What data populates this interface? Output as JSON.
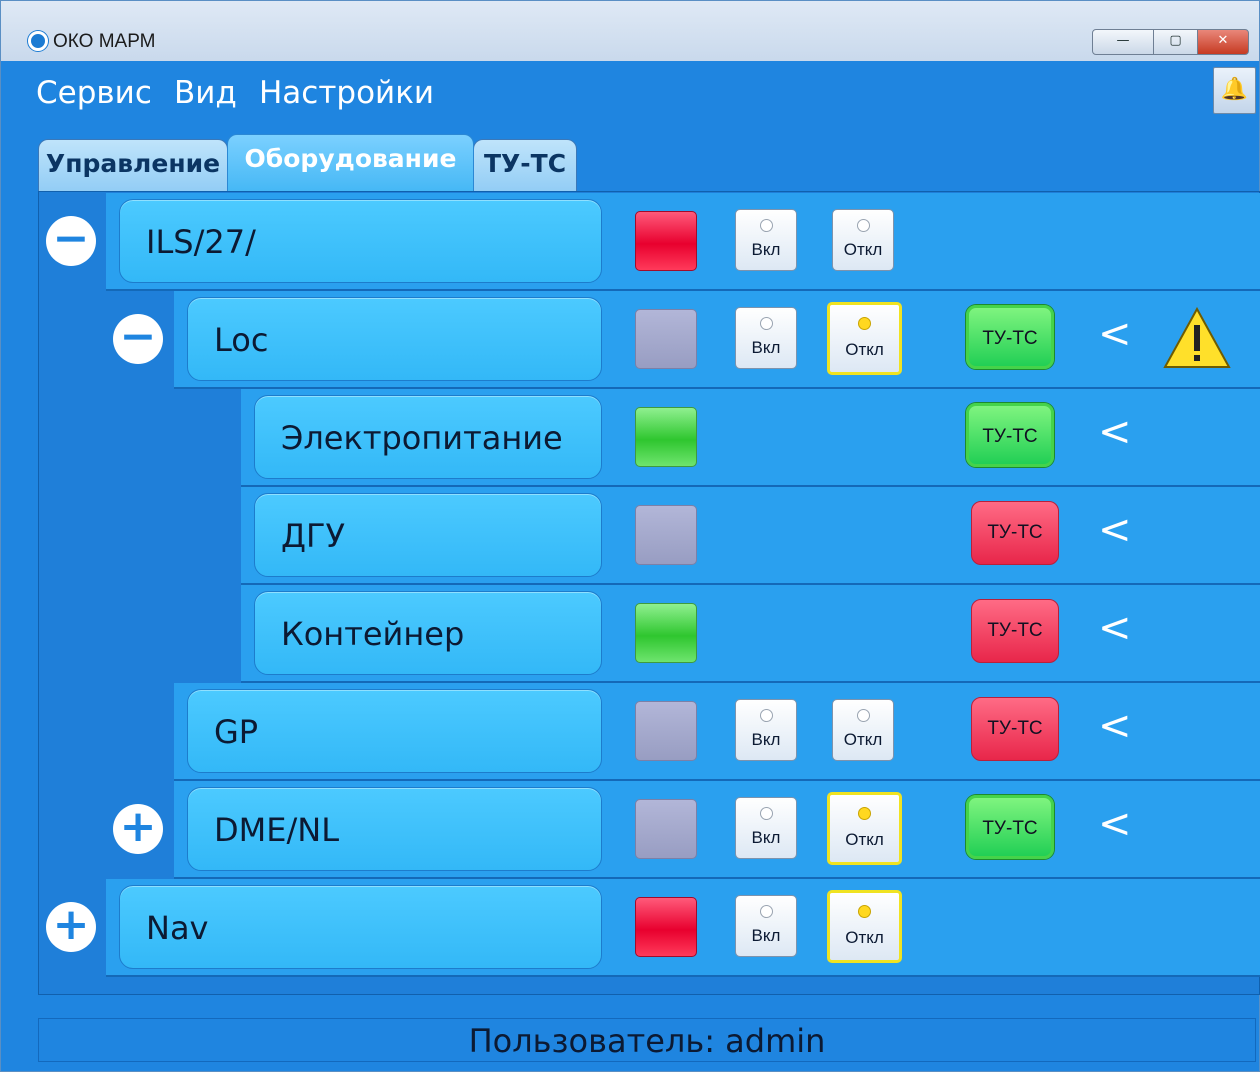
{
  "window": {
    "title": "ОКО МАРМ",
    "controls": {
      "minimize": "—",
      "maximize": "▢",
      "close": "✕"
    }
  },
  "menu": {
    "items": [
      "Сервис",
      "Вид",
      "Настройки"
    ],
    "bell_icon": "bell-icon"
  },
  "tabs": [
    {
      "label": "Управление",
      "active": false
    },
    {
      "label": "Оборудование",
      "active": true
    },
    {
      "label": "ТУ-ТС",
      "active": false
    }
  ],
  "tree": {
    "rows": [
      {
        "name": "ILS/27/",
        "level": 0,
        "toggle": "−",
        "status": "red",
        "buttons": {
          "on": "Вкл",
          "off": "Откл"
        },
        "off_selected": false,
        "tutc": null
      },
      {
        "name": "Loc",
        "level": 1,
        "toggle": "−",
        "status": "gray",
        "buttons": {
          "on": "Вкл",
          "off": "Откл"
        },
        "off_selected": true,
        "tutc": {
          "label": "ТУ-ТС",
          "state": "green"
        },
        "warning": true
      },
      {
        "name": "Электропитание",
        "level": 2,
        "toggle": null,
        "status": "green",
        "buttons": null,
        "tutc": {
          "label": "ТУ-ТС",
          "state": "green"
        }
      },
      {
        "name": "ДГУ",
        "level": 2,
        "toggle": null,
        "status": "gray",
        "buttons": null,
        "tutc": {
          "label": "ТУ-ТС",
          "state": "red"
        }
      },
      {
        "name": "Контейнер",
        "level": 2,
        "toggle": null,
        "status": "green",
        "buttons": null,
        "tutc": {
          "label": "ТУ-ТС",
          "state": "red"
        }
      },
      {
        "name": "GP",
        "level": 1,
        "toggle": null,
        "status": "gray",
        "buttons": {
          "on": "Вкл",
          "off": "Откл"
        },
        "off_selected": false,
        "tutc": {
          "label": "ТУ-ТС",
          "state": "red"
        }
      },
      {
        "name": "DME/NL",
        "level": 1,
        "toggle": "+",
        "status": "gray",
        "buttons": {
          "on": "Вкл",
          "off": "Откл"
        },
        "off_selected": true,
        "tutc": {
          "label": "ТУ-ТС",
          "state": "green"
        }
      },
      {
        "name": "Nav",
        "level": 0,
        "toggle": "+",
        "status": "red",
        "buttons": {
          "on": "Вкл",
          "off": "Откл"
        },
        "off_selected": true,
        "tutc": null
      }
    ],
    "chevron": "<"
  },
  "statusbar": {
    "text": "Пользователь: admin"
  },
  "colors": {
    "accent": "#1f85e0",
    "row": "#2aa0ef",
    "label": "#3fc2fc"
  }
}
